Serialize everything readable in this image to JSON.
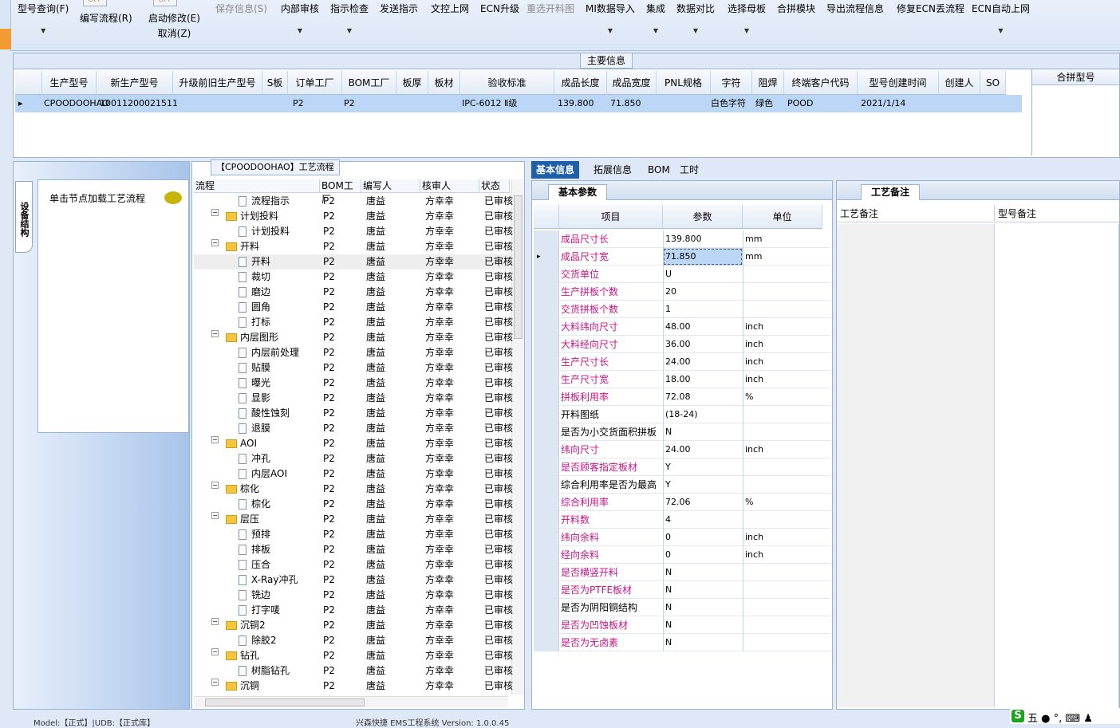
{
  "toolbar": {
    "items": [
      {
        "label": "型号查询(F)",
        "dd": true
      },
      {
        "label": "编写流程(R)"
      },
      {
        "label": "启动修改(E)",
        "sub": "取消(Z)"
      },
      {
        "label": "保存信息(S)",
        "disabled": true
      },
      {
        "label": "内部审核",
        "dd": true
      },
      {
        "label": "指示检查",
        "dd": true
      },
      {
        "label": "发送指示"
      },
      {
        "label": "文控上网"
      },
      {
        "label": "ECN升级"
      },
      {
        "label": "重选开料图",
        "disabled": true
      },
      {
        "label": "MI数据导入",
        "dd": true
      },
      {
        "label": "集成",
        "dd": true
      },
      {
        "label": "数据对比",
        "dd": true
      },
      {
        "label": "选择母板",
        "dd": true
      },
      {
        "label": "合拼模块"
      },
      {
        "label": "导出流程信息"
      },
      {
        "label": "修复ECN丢流程"
      },
      {
        "label": "ECN自动上网",
        "dd": true
      }
    ],
    "box_labels": [
      "OFF",
      "OFF"
    ]
  },
  "main_info": {
    "title": "主要信息",
    "columns": [
      "生产型号",
      "新生产型号",
      "升级前旧生产型号",
      "S板",
      "订单工厂",
      "BOM工厂",
      "板厚",
      "板材",
      "验收标准",
      "成品长度",
      "成品宽度",
      "PNL规格",
      "字符",
      "阻焊",
      "终端客户代码",
      "型号创建时间",
      "创建人",
      "SO"
    ],
    "row": {
      "prod": "CPOODOOHAO",
      "newprod": "10011200021511",
      "order_factory": "P2",
      "bom_factory": "P2",
      "standard": "IPC-6012 Ⅱ级",
      "length": "139.800",
      "width": "71.850",
      "char": "白色字符",
      "mask": "绿色",
      "client": "POOD",
      "created": "2021/1/14"
    },
    "merge_col": "合拼型号"
  },
  "left_panel": {
    "vtab": "设备结构",
    "hint": "单击节点加载工艺流程"
  },
  "tree": {
    "title": "【CPOODOOHAO】工艺流程",
    "headers": [
      "流程",
      "BOM工厂",
      "编写人",
      "核审人",
      "状态"
    ],
    "rows": [
      {
        "name": "流程指示",
        "lvl": 1,
        "f": "P2",
        "w": "唐益",
        "r": "方幸幸",
        "s": "已审核"
      },
      {
        "name": "计划投料",
        "lvl": 0,
        "f": "P2",
        "w": "唐益",
        "r": "方幸幸",
        "s": "已审核"
      },
      {
        "name": "计划投料",
        "lvl": 1,
        "f": "P2",
        "w": "唐益",
        "r": "方幸幸",
        "s": "已审核"
      },
      {
        "name": "开料",
        "lvl": 0,
        "f": "P2",
        "w": "唐益",
        "r": "方幸幸",
        "s": "已审核"
      },
      {
        "name": "开料",
        "lvl": 1,
        "f": "P2",
        "w": "唐益",
        "r": "方幸幸",
        "s": "已审核",
        "sel": true
      },
      {
        "name": "裁切",
        "lvl": 1,
        "f": "P2",
        "w": "唐益",
        "r": "方幸幸",
        "s": "已审核"
      },
      {
        "name": "磨边",
        "lvl": 1,
        "f": "P2",
        "w": "唐益",
        "r": "方幸幸",
        "s": "已审核"
      },
      {
        "name": "圆角",
        "lvl": 1,
        "f": "P2",
        "w": "唐益",
        "r": "方幸幸",
        "s": "已审核"
      },
      {
        "name": "打标",
        "lvl": 1,
        "f": "P2",
        "w": "唐益",
        "r": "方幸幸",
        "s": "已审核"
      },
      {
        "name": "内层图形",
        "lvl": 0,
        "f": "P2",
        "w": "唐益",
        "r": "方幸幸",
        "s": "已审核"
      },
      {
        "name": "内层前处理",
        "lvl": 1,
        "f": "P2",
        "w": "唐益",
        "r": "方幸幸",
        "s": "已审核"
      },
      {
        "name": "贴膜",
        "lvl": 1,
        "f": "P2",
        "w": "唐益",
        "r": "方幸幸",
        "s": "已审核"
      },
      {
        "name": "曝光",
        "lvl": 1,
        "f": "P2",
        "w": "唐益",
        "r": "方幸幸",
        "s": "已审核"
      },
      {
        "name": "显影",
        "lvl": 1,
        "f": "P2",
        "w": "唐益",
        "r": "方幸幸",
        "s": "已审核"
      },
      {
        "name": "酸性蚀刻",
        "lvl": 1,
        "f": "P2",
        "w": "唐益",
        "r": "方幸幸",
        "s": "已审核"
      },
      {
        "name": "退膜",
        "lvl": 1,
        "f": "P2",
        "w": "唐益",
        "r": "方幸幸",
        "s": "已审核"
      },
      {
        "name": "AOI",
        "lvl": 0,
        "f": "P2",
        "w": "唐益",
        "r": "方幸幸",
        "s": "已审核"
      },
      {
        "name": "冲孔",
        "lvl": 1,
        "f": "P2",
        "w": "唐益",
        "r": "方幸幸",
        "s": "已审核"
      },
      {
        "name": "内层AOI",
        "lvl": 1,
        "f": "P2",
        "w": "唐益",
        "r": "方幸幸",
        "s": "已审核"
      },
      {
        "name": "棕化",
        "lvl": 0,
        "f": "P2",
        "w": "唐益",
        "r": "方幸幸",
        "s": "已审核"
      },
      {
        "name": "棕化",
        "lvl": 1,
        "f": "P2",
        "w": "唐益",
        "r": "方幸幸",
        "s": "已审核"
      },
      {
        "name": "层压",
        "lvl": 0,
        "f": "P2",
        "w": "唐益",
        "r": "方幸幸",
        "s": "已审核"
      },
      {
        "name": "预排",
        "lvl": 1,
        "f": "P2",
        "w": "唐益",
        "r": "方幸幸",
        "s": "已审核"
      },
      {
        "name": "排板",
        "lvl": 1,
        "f": "P2",
        "w": "唐益",
        "r": "方幸幸",
        "s": "已审核"
      },
      {
        "name": "压合",
        "lvl": 1,
        "f": "P2",
        "w": "唐益",
        "r": "方幸幸",
        "s": "已审核"
      },
      {
        "name": "X-Ray冲孔",
        "lvl": 1,
        "f": "P2",
        "w": "唐益",
        "r": "方幸幸",
        "s": "已审核"
      },
      {
        "name": "铣边",
        "lvl": 1,
        "f": "P2",
        "w": "唐益",
        "r": "方幸幸",
        "s": "已审核"
      },
      {
        "name": "打字唛",
        "lvl": 1,
        "f": "P2",
        "w": "唐益",
        "r": "方幸幸",
        "s": "已审核"
      },
      {
        "name": "沉铜2",
        "lvl": 0,
        "f": "P2",
        "w": "唐益",
        "r": "方幸幸",
        "s": "已审核"
      },
      {
        "name": "除胶2",
        "lvl": 1,
        "f": "P2",
        "w": "唐益",
        "r": "方幸幸",
        "s": "已审核"
      },
      {
        "name": "钻孔",
        "lvl": 0,
        "f": "P2",
        "w": "唐益",
        "r": "方幸幸",
        "s": "已审核"
      },
      {
        "name": "树脂钻孔",
        "lvl": 1,
        "f": "P2",
        "w": "唐益",
        "r": "方幸幸",
        "s": "已审核"
      },
      {
        "name": "沉铜",
        "lvl": 0,
        "f": "P2",
        "w": "唐益",
        "r": "方幸幸",
        "s": "已审核"
      }
    ]
  },
  "right_tabs": [
    "基本信息",
    "拓展信息",
    "BOM",
    "工时"
  ],
  "basic": {
    "title": "基本参数",
    "headers": [
      "项目",
      "参数",
      "单位"
    ],
    "rows": [
      {
        "k": "成品尺寸长",
        "v": "139.800",
        "u": "mm",
        "pink": true
      },
      {
        "k": "成品尺寸宽",
        "v": "71.850",
        "u": "mm",
        "pink": true,
        "sel": true
      },
      {
        "k": "交货单位",
        "v": "U",
        "u": "",
        "pink": true
      },
      {
        "k": "生产拼板个数",
        "v": "20",
        "u": "",
        "pink": true
      },
      {
        "k": "交货拼板个数",
        "v": "1",
        "u": "",
        "pink": true
      },
      {
        "k": "大料纬向尺寸",
        "v": "48.00",
        "u": "inch",
        "pink": true
      },
      {
        "k": "大料经向尺寸",
        "v": "36.00",
        "u": "inch",
        "pink": true
      },
      {
        "k": "生产尺寸长",
        "v": "24.00",
        "u": "inch",
        "pink": true
      },
      {
        "k": "生产尺寸宽",
        "v": "18.00",
        "u": "inch",
        "pink": true
      },
      {
        "k": "拼板利用率",
        "v": "72.08",
        "u": "%",
        "pink": true
      },
      {
        "k": "开料图纸",
        "v": "(18-24)",
        "u": "",
        "pink": false
      },
      {
        "k": "是否为小交货面积拼板",
        "v": "N",
        "u": "",
        "pink": false
      },
      {
        "k": "纬向尺寸",
        "v": "24.00",
        "u": "inch",
        "pink": true
      },
      {
        "k": "是否顾客指定板材",
        "v": "Y",
        "u": "",
        "pink": true
      },
      {
        "k": "综合利用率是否为最高",
        "v": "Y",
        "u": "",
        "pink": false
      },
      {
        "k": "综合利用率",
        "v": "72.06",
        "u": "%",
        "pink": true
      },
      {
        "k": "开料数",
        "v": "4",
        "u": "",
        "pink": true
      },
      {
        "k": "纬向余料",
        "v": "0",
        "u": "inch",
        "pink": true
      },
      {
        "k": "经向余料",
        "v": "0",
        "u": "inch",
        "pink": true
      },
      {
        "k": "是否横竖开料",
        "v": "N",
        "u": "",
        "pink": true
      },
      {
        "k": "是否为PTFE板材",
        "v": "N",
        "u": "",
        "pink": true
      },
      {
        "k": "是否为阴阳铜结构",
        "v": "N",
        "u": "",
        "pink": false
      },
      {
        "k": "是否为凹蚀板材",
        "v": "N",
        "u": "",
        "pink": true
      },
      {
        "k": "是否为无卤素",
        "v": "N",
        "u": "",
        "pink": true
      }
    ]
  },
  "craft": {
    "title": "工艺备注",
    "col1": "工艺备注",
    "col2": "型号备注"
  },
  "status": {
    "left": "Model:【正式】|UDB:【正式库】",
    "center": "兴森快捷 EMS工程系统 Version: 1.0.0.45"
  },
  "ime": {
    "logo": "S",
    "text": "五 ● °, ⌨ ♟"
  }
}
